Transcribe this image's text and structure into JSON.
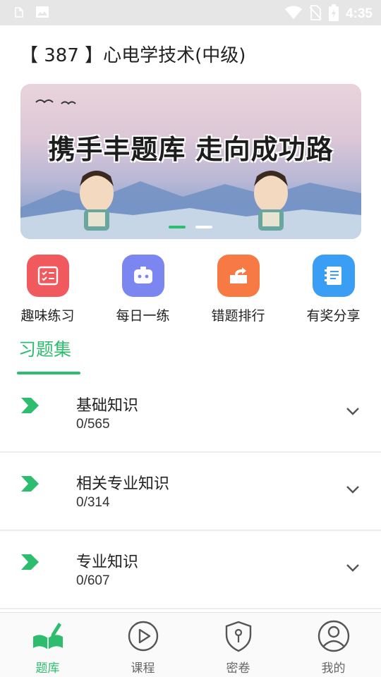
{
  "status_bar": {
    "time": "4:35",
    "icons": [
      "clipboard-icon",
      "image-icon",
      "wifi-icon",
      "no-sim-icon",
      "battery-charging-icon"
    ]
  },
  "page": {
    "title": "【 387 】心电学技术(中级)"
  },
  "banner": {
    "slogan": "携手丰题库 走向成功路",
    "active_dot": 0
  },
  "features": [
    {
      "label": "趣味练习",
      "icon": "checklist-icon",
      "color": "#f05a5f"
    },
    {
      "label": "每日一练",
      "icon": "robot-icon",
      "color": "#7b86f0"
    },
    {
      "label": "错题排行",
      "icon": "share-box-icon",
      "color": "#f77a45"
    },
    {
      "label": "有奖分享",
      "icon": "notebook-icon",
      "color": "#3a9ef5"
    }
  ],
  "section": {
    "title": "习题集"
  },
  "exercise_sets": [
    {
      "title": "基础知识",
      "progress": "0/565"
    },
    {
      "title": "相关专业知识",
      "progress": "0/314"
    },
    {
      "title": "专业知识",
      "progress": "0/607"
    }
  ],
  "tabs": [
    {
      "label": "题库",
      "icon": "book-pen-icon",
      "active": true
    },
    {
      "label": "课程",
      "icon": "play-circle-icon",
      "active": false
    },
    {
      "label": "密卷",
      "icon": "shield-key-icon",
      "active": false
    },
    {
      "label": "我的",
      "icon": "user-circle-icon",
      "active": false
    }
  ],
  "colors": {
    "accent": "#2ebd6e",
    "status_bar": "#e6e6e6"
  }
}
